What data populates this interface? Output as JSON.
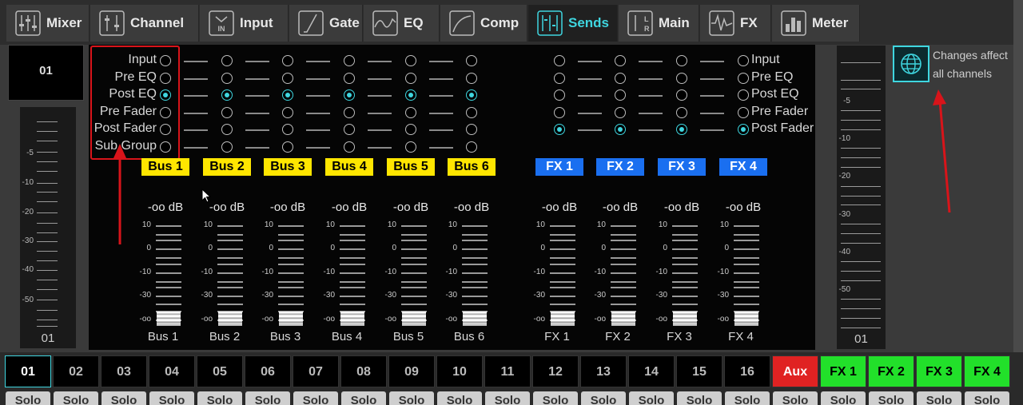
{
  "tabs": [
    {
      "label": "Mixer",
      "icon": "mixer-icon"
    },
    {
      "label": "Channel",
      "icon": "channel-icon"
    },
    {
      "label": "Input",
      "icon": "input-icon"
    },
    {
      "label": "Gate",
      "icon": "gate-icon"
    },
    {
      "label": "EQ",
      "icon": "eq-icon"
    },
    {
      "label": "Comp",
      "icon": "comp-icon"
    },
    {
      "label": "Sends",
      "icon": "sends-icon"
    },
    {
      "label": "Main",
      "icon": "main-icon"
    },
    {
      "label": "FX",
      "icon": "fx-icon"
    },
    {
      "label": "Meter",
      "icon": "meter-icon"
    }
  ],
  "active_tab": "Sends",
  "channel": {
    "name": "01",
    "meter_label": "01"
  },
  "left_meter_scale": [
    "-5",
    "-10",
    "-20",
    "-30",
    "-40",
    "-50"
  ],
  "right_meter_scale": [
    "-5",
    "-10",
    "-20",
    "-30",
    "-40",
    "-50"
  ],
  "right_meter_label": "01",
  "send_points": [
    "Input",
    "Pre EQ",
    "Post EQ",
    "Pre Fader",
    "Post Fader",
    "Sub Group"
  ],
  "fx_send_points": [
    "Input",
    "Pre EQ",
    "Post EQ",
    "Pre Fader",
    "Post Fader"
  ],
  "bus_send_selected": "Post EQ",
  "fx_send_selected": "Post Fader",
  "buses": [
    {
      "label": "Bus 1",
      "db": "-oo dB",
      "name": "Bus 1"
    },
    {
      "label": "Bus 2",
      "db": "-oo dB",
      "name": "Bus 2"
    },
    {
      "label": "Bus 3",
      "db": "-oo dB",
      "name": "Bus 3"
    },
    {
      "label": "Bus 4",
      "db": "-oo dB",
      "name": "Bus 4"
    },
    {
      "label": "Bus 5",
      "db": "-oo dB",
      "name": "Bus 5"
    },
    {
      "label": "Bus 6",
      "db": "-oo dB",
      "name": "Bus 6"
    }
  ],
  "fx": [
    {
      "label": "FX 1",
      "db": "-oo dB",
      "name": "FX 1"
    },
    {
      "label": "FX 2",
      "db": "-oo dB",
      "name": "FX 2"
    },
    {
      "label": "FX 3",
      "db": "-oo dB",
      "name": "FX 3"
    },
    {
      "label": "FX 4",
      "db": "-oo dB",
      "name": "FX 4"
    }
  ],
  "fader_scale": [
    "10",
    "0",
    "-10",
    "-30",
    "-oo"
  ],
  "global_note": {
    "line1": "Changes affect",
    "line2": "all channels"
  },
  "channels": [
    "01",
    "02",
    "03",
    "04",
    "05",
    "06",
    "07",
    "08",
    "09",
    "10",
    "11",
    "12",
    "13",
    "14",
    "15",
    "16"
  ],
  "aux": "Aux",
  "fx_channels": [
    "FX 1",
    "FX 2",
    "FX 3",
    "FX 4"
  ],
  "solo_label": "Solo",
  "colors": {
    "accent": "#3fd6e0",
    "bus_badge": "#ffe600",
    "fx_badge": "#1a6ff0",
    "aux_btn": "#e02222",
    "fx_btn": "#22e02a",
    "annotation": "#d8141a"
  }
}
